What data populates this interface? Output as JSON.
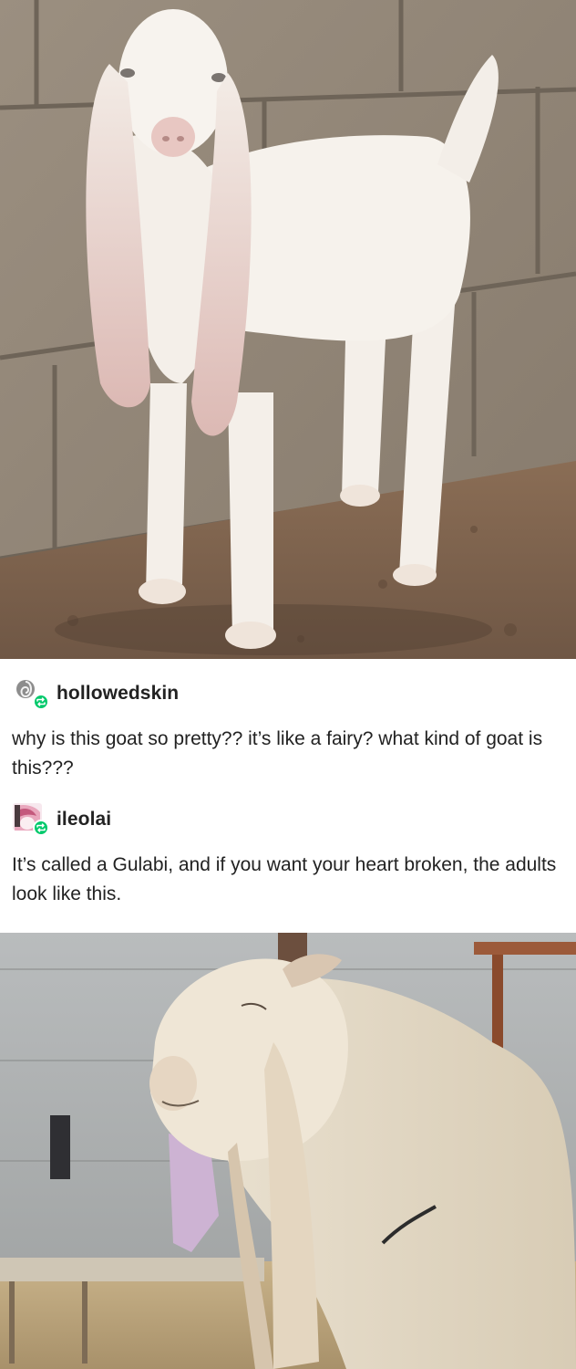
{
  "post": {
    "reblogs": [
      {
        "username": "hollowedskin",
        "text": "why is this goat so pretty?? it’s like a fairy? what kind of goat is this???",
        "avatar_icon": "gray-spiral-avatar-icon"
      },
      {
        "username": "ileolai",
        "text": "It’s called a Gulabi, and if you want your heart broken, the adults look like this.",
        "avatar_icon": "pink-anime-avatar-icon"
      }
    ],
    "reblog_icon": "reblog-icon",
    "reblog_icon_color": "#00c96b"
  },
  "photos": [
    {
      "subject": "white goat kid with long floppy ears standing by a cinder block wall"
    },
    {
      "subject": "adult white Gulabi goat with long ears in a yard"
    }
  ]
}
